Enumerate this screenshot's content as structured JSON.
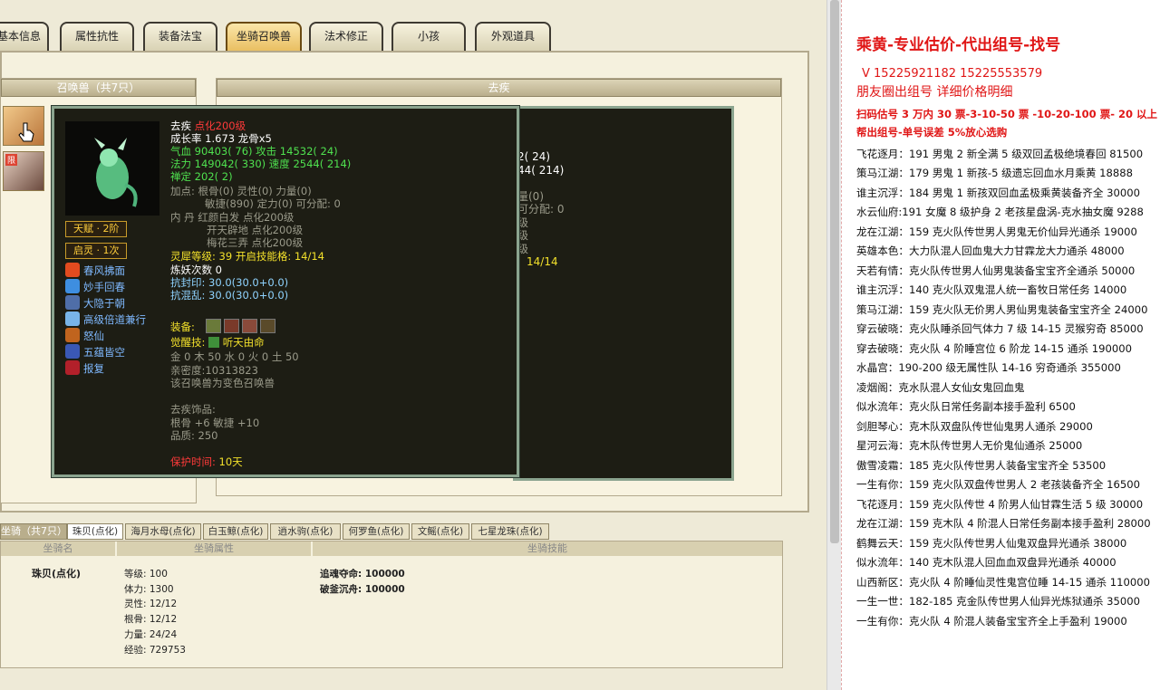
{
  "tabs": [
    "基本信息",
    "属性抗性",
    "装备法宝",
    "坐骑召唤兽",
    "法术修正",
    "小孩",
    "外观道具"
  ],
  "pet_list": {
    "header": "召唤兽（共7只）",
    "limit_badge": "限"
  },
  "detail": {
    "header": "去疾"
  },
  "tooltip": {
    "name": "去疾",
    "name_tag": "点化200级",
    "growth": "成长率 1.673 龙骨x5",
    "hp_attack": "气血 90403( 76) 攻击 14532( 24)",
    "mp_speed": "法力 149042( 330) 速度 2544( 214)",
    "spirit": "禅定 202( 2)",
    "points1": "加点: 根骨(0) 灵性(0) 力量(0)",
    "points2": "敏捷(890) 定力(0) 可分配: 0",
    "inner1": "内    丹 红颜白发 点化200级",
    "inner2": "开天辟地 点化200级",
    "inner3": "梅花三弄 点化200级",
    "spirit_level": "灵犀等级:  39 开启技能格:  14/14",
    "refine": "炼妖次数 0",
    "resist_seal": "抗封印: 30.0(30.0+0.0)",
    "resist_chaos": "抗混乱: 30.0(30.0+0.0)",
    "talent": "天赋 · 2阶",
    "awaken_soul": "启灵 · 1次",
    "skills": [
      "春风拂面",
      "妙手回春",
      "大隐于朝",
      "高级倍道兼行",
      "怒仙",
      "五蕴皆空",
      "报复"
    ],
    "equip_label": "装备:",
    "awaken_label": "觉醒技:",
    "awaken_skill": "听天由命",
    "elements": "金 0 木 50 水 0 火 0 土 50",
    "intimacy": "亲密度:10313823",
    "morph_note": "该召唤兽为变色召唤兽",
    "accessory_title": "去疾饰品:",
    "accessory_attr": "根骨 +6 敏捷 +10",
    "accessory_quality": "品质:  250",
    "protect_label": "保护时间:",
    "protect_value": "10天"
  },
  "behind_text": {
    "a": "2( 24)",
    "b": "44( 214)",
    "c": "量(0)",
    "d": "可分配: 0",
    "e": "级",
    "f": "级",
    "g": "级",
    "h": "14/14"
  },
  "mount_tabs": [
    "坐骑（共7只）",
    "珠贝(点化)",
    "海月水母(点化)",
    "白玉鲸(点化)",
    "逍水驹(点化)",
    "何罗鱼(点化)",
    "文鳐(点化)",
    "七星龙珠(点化)"
  ],
  "mount": {
    "head_name": "坐骑名",
    "head_attr": "坐骑属性",
    "head_skill": "坐骑技能",
    "name": "珠贝(点化)",
    "attrs": [
      "等级: 100",
      "体力: 1300",
      "灵性: 12/12",
      "根骨: 12/12",
      "力量: 24/24",
      "经验: 729753"
    ],
    "skills": [
      "追魂夺命:  100000",
      "破釜沉舟:  100000"
    ]
  },
  "doc": {
    "title": "乘黄-专业估价-代出组号-找号",
    "phone": "V 15225921182   15225553579",
    "circle": "朋友圈出组号    详细价格明细",
    "price": "扫码估号 3 万内 30 票-3-10-50 票  -10-20-100 票- 20 以上 150",
    "help": "帮出组号-单号误差 5%放心选购",
    "lines": [
      "飞花逐月：191 男鬼 2 新全满 5 级双回孟极绝境春回 81500",
      "策马江湖：179 男鬼 1 新孩-5 级遗忘回血水月乘黄 18888",
      "谁主沉浮：184 男鬼 1 新孩双回血孟极乘黄装备齐全 30000",
      "水云仙府:191 女魔 8 级护身 2 老孩星盘涡-克水抽女魔 9288",
      "龙在江湖：159 克火队传世男人男鬼无价仙异光通杀 19000",
      "英雄本色：大力队混人回血鬼大力甘霖龙大力通杀 48000",
      "天若有情：克火队传世男人仙男鬼装备宝宝齐全通杀 50000",
      "谁主沉浮：140 克火队双鬼混人统一畜牧日常任务 14000",
      "策马江湖：159 克火队无价男人男仙男鬼装备宝宝齐全 24000",
      "穿云破晓：克火队睡杀回气体力 7 级 14-15 灵猴穷奇 85000",
      "穿去破晓：克火队 4 阶睡宫位 6 阶龙 14-15 通杀 190000",
      "水晶宫：190-200 级无属性队 14-16 穷奇通杀 355000",
      "凌烟阁：克水队混人女仙女鬼回血鬼",
      "似水流年：克火队日常任务副本接手盈利 6500",
      "剑胆琴心：克木队双盘队传世仙鬼男人通杀 29000",
      "星河云海：克木队传世男人无价鬼仙通杀 25000",
      "傲雪凌霜：185 克火队传世男人装备宝宝齐全 53500",
      "一生有你：159 克火队双盘传世男人 2 老孩装备齐全 16500",
      "飞花逐月：159 克火队传世 4 阶男人仙甘霖生活 5 级 30000",
      "龙在江湖：159 克木队 4 阶混人日常任务副本接手盈利 28000",
      "鹤舞云天：159 克火队传世男人仙鬼双盘异光通杀 38000",
      "似水流年：140 克木队混人回血血双盘异光通杀 40000",
      "山西新区：克火队 4 阶睡仙灵性鬼宫位睡 14-15 通杀 110000",
      "一生一世：182-185 克金队传世男人仙异光炼狱通杀 35000",
      "一生有你：克火队 4 阶混人装备宝宝齐全上手盈利 19000"
    ]
  }
}
